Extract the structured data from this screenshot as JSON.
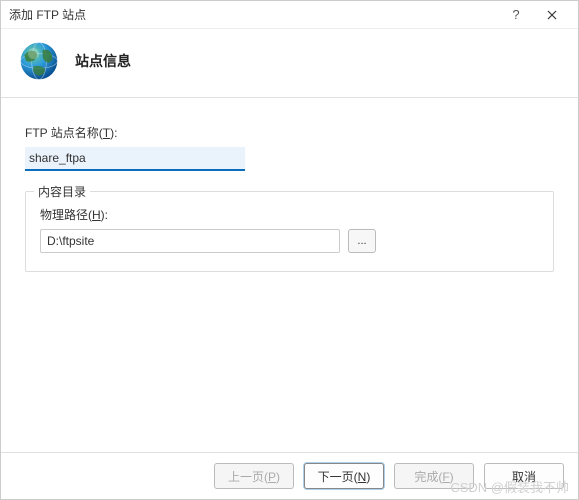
{
  "titlebar": {
    "title": "添加 FTP 站点"
  },
  "header": {
    "title": "站点信息"
  },
  "body": {
    "site_name_label_prefix": "FTP 站点名称(",
    "site_name_label_key": "T",
    "site_name_label_suffix": "):",
    "site_name_value": "share_ftpa",
    "content_dir_legend": "内容目录",
    "physical_path_label_prefix": "物理路径(",
    "physical_path_label_key": "H",
    "physical_path_label_suffix": "):",
    "physical_path_value": "D:\\ftpsite",
    "browse_label": "..."
  },
  "footer": {
    "prev_prefix": "上一页(",
    "prev_key": "P",
    "prev_suffix": ")",
    "next_prefix": "下一页(",
    "next_key": "N",
    "next_suffix": ")",
    "finish_prefix": "完成(",
    "finish_key": "F",
    "finish_suffix": ")",
    "cancel": "取消"
  },
  "watermark": "CSDN @假装我不帅"
}
